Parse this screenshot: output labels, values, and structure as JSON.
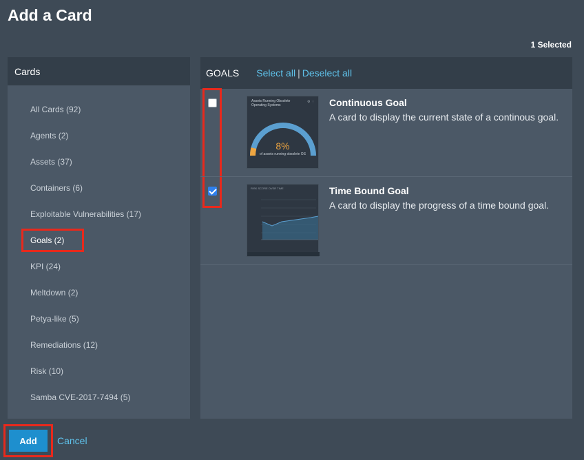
{
  "page": {
    "title": "Add a Card",
    "selected_count": "1 Selected"
  },
  "sidebar": {
    "header": "Cards",
    "items": [
      {
        "label": "All Cards (92)"
      },
      {
        "label": "Agents (2)"
      },
      {
        "label": "Assets (37)"
      },
      {
        "label": "Containers (6)"
      },
      {
        "label": "Exploitable Vulnerabilities (17)"
      },
      {
        "label": "Goals (2)",
        "active": true
      },
      {
        "label": "KPI (24)"
      },
      {
        "label": "Meltdown (2)"
      },
      {
        "label": "Petya-like (5)"
      },
      {
        "label": "Remediations (12)"
      },
      {
        "label": "Risk (10)"
      },
      {
        "label": "Samba CVE-2017-7494 (5)"
      }
    ]
  },
  "main": {
    "section_label": "GOALS",
    "select_all": "Select all",
    "divider": "|",
    "deselect_all": "Deselect all",
    "cards": [
      {
        "title": "Continuous Goal",
        "description": "A card to display the current state of a continous goal.",
        "checked": false,
        "thumb_title": "Assets Running Obsolete Operating Systems",
        "thumb_value": "8%",
        "thumb_caption": "of assets running obsolete OS",
        "gauge_fraction": 0.08
      },
      {
        "title": "Time Bound Goal",
        "description": "A card to display the progress of a time bound goal.",
        "checked": true,
        "thumb_title": "RISK SCORE OVER TIME"
      }
    ]
  },
  "footer": {
    "add_label": "Add",
    "cancel_label": "Cancel"
  },
  "colors": {
    "accent": "#1e8fce",
    "link": "#5fc3ec",
    "highlight": "#e8291c",
    "gauge": "#5b9fd0",
    "gauge_value": "#f0a640"
  }
}
